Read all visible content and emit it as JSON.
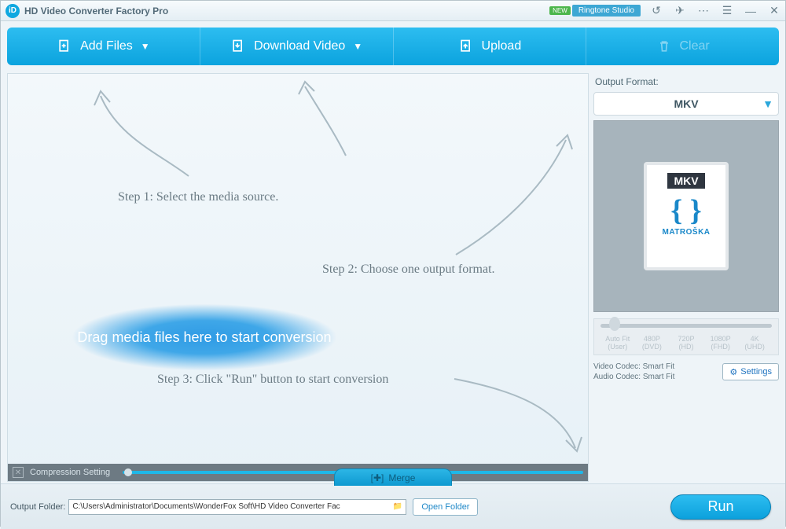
{
  "title": "HD Video Converter Factory Pro",
  "titlebar": {
    "new_badge": "NEW",
    "ringtone": "Ringtone Studio"
  },
  "toolbar": {
    "add_files": "Add Files",
    "download_video": "Download Video",
    "upload": "Upload",
    "clear": "Clear"
  },
  "canvas": {
    "step1": "Step 1: Select the media source.",
    "step2": "Step 2: Choose one output format.",
    "step3": "Step 3: Click \"Run\" button to start conversion",
    "drag_hint": "Drag media files here to start conversion",
    "compression_label": "Compression Setting"
  },
  "sidebar": {
    "output_format_label": "Output Format:",
    "selected_format": "MKV",
    "format_card": {
      "title": "MKV",
      "subtitle": "MATROŠKA"
    },
    "resolutions": [
      {
        "name": "Auto Fit",
        "sub": "(User)"
      },
      {
        "name": "480P",
        "sub": "(DVD)"
      },
      {
        "name": "720P",
        "sub": "(HD)"
      },
      {
        "name": "1080P",
        "sub": "(FHD)"
      },
      {
        "name": "4K",
        "sub": "(UHD)"
      }
    ],
    "video_codec": "Video Codec: Smart Fit",
    "audio_codec": "Audio Codec: Smart Fit",
    "settings_label": "Settings"
  },
  "bottombar": {
    "merge": "Merge",
    "output_folder_label": "Output Folder:",
    "output_path": "C:\\Users\\Administrator\\Documents\\WonderFox Soft\\HD Video Converter Fac",
    "open_folder": "Open Folder",
    "run": "Run"
  }
}
